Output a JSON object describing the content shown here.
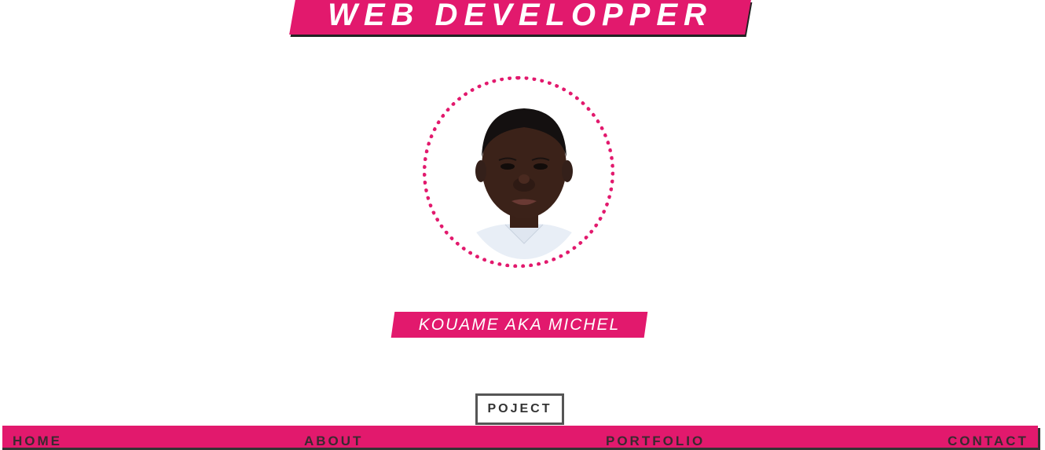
{
  "header": {
    "title": "WEB DEVELOPPER"
  },
  "profile": {
    "name": "KOUAME AKA MICHEL",
    "photo_icon": "portrait-photo"
  },
  "actions": {
    "project_button": "POJECT"
  },
  "nav": {
    "items": [
      {
        "label": "HOME"
      },
      {
        "label": "ABOUT"
      },
      {
        "label": "PORTFOLIO"
      },
      {
        "label": "CONTACT"
      }
    ]
  },
  "colors": {
    "accent": "#e2196d",
    "text_dark": "#333333",
    "background": "#ffffff"
  }
}
